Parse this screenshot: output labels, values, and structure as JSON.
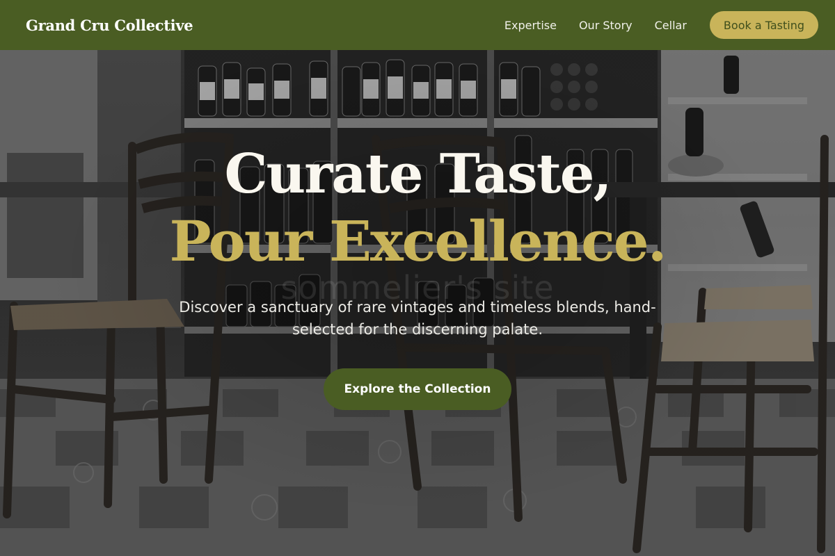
{
  "header": {
    "logo": "Grand Cru Collective",
    "nav": [
      {
        "label": "Expertise"
      },
      {
        "label": "Our Story"
      },
      {
        "label": "Cellar"
      }
    ],
    "cta_label": "Book a Tasting"
  },
  "hero": {
    "headline_line1": "Curate Taste,",
    "headline_line2": "Pour Excellence.",
    "watermark": "sommelier's site",
    "subtitle": "Discover a sanctuary of rare vintages and timeless blends, hand-selected for the discerning palate.",
    "cta_label": "Explore the Collection",
    "background_image": "grayscale-wine-bar-chairs-photo"
  },
  "colors": {
    "header_bg": "#4a5d23",
    "accent_gold": "#c9b45a",
    "headline_white": "#faf7ef",
    "cta_green": "#4a5d23"
  }
}
